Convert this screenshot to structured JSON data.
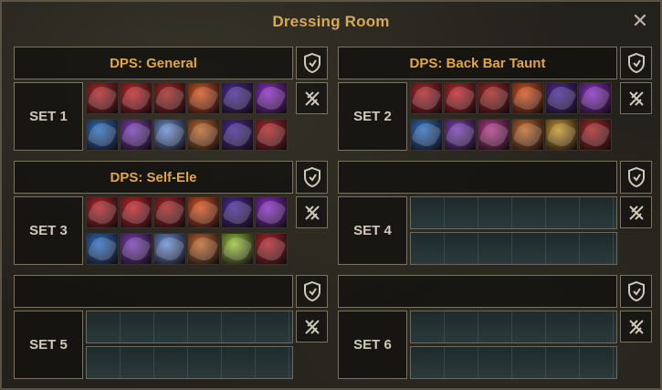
{
  "window": {
    "title": "Dressing Room",
    "close_icon": "close-x-icon"
  },
  "outfits": [
    {
      "name": "DPS: General"
    },
    {
      "name": "DPS: Back Bar Taunt"
    },
    {
      "name": "DPS: Self-Ele"
    },
    {
      "name": ""
    },
    {
      "name": ""
    },
    {
      "name": ""
    }
  ],
  "sets": [
    {
      "label": "SET 1",
      "front": [
        "#b3262a",
        "#c4262a",
        "#a82624",
        "#d9541e",
        "#4a2a9a",
        "#8a2ec9"
      ],
      "back": [
        "#2d6fc2",
        "#7a3fb8",
        "#6a8fd4",
        "#c06a2a",
        "#4a2a9a",
        "#b3262a"
      ]
    },
    {
      "label": "SET 2",
      "front": [
        "#b3262a",
        "#c4262a",
        "#a82624",
        "#d9541e",
        "#4a2a9a",
        "#8a2ec9"
      ],
      "back": [
        "#2d6fc2",
        "#7a3fb8",
        "#b33a8a",
        "#c06a2a",
        "#c8962a",
        "#a82624"
      ]
    },
    {
      "label": "SET 3",
      "front": [
        "#b3262a",
        "#c4262a",
        "#a82624",
        "#d9541e",
        "#4a2a9a",
        "#8a2ec9"
      ],
      "back": [
        "#2d6fc2",
        "#7a3fb8",
        "#6a8fd4",
        "#c06a2a",
        "#9ac43a",
        "#b3262a"
      ]
    },
    {
      "label": "SET 4",
      "front": [],
      "back": []
    },
    {
      "label": "SET 5",
      "front": [],
      "back": []
    },
    {
      "label": "SET 6",
      "front": [],
      "back": []
    }
  ],
  "icons": {
    "outfit_button": "shield-icon",
    "skills_button": "crossed-swords-icon"
  }
}
